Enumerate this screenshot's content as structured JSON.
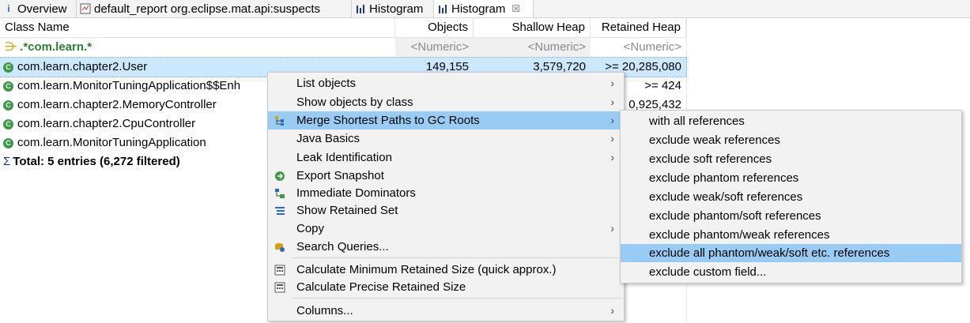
{
  "tabs": [
    {
      "label": "Overview",
      "icon": "info-icon"
    },
    {
      "label": "default_report  org.eclipse.mat.api:suspects",
      "icon": "report-icon"
    },
    {
      "label": "Histogram",
      "icon": "histogram-icon"
    },
    {
      "label": "Histogram",
      "icon": "histogram-icon",
      "active": true,
      "close": "☒"
    }
  ],
  "columns": {
    "class_name": "Class Name",
    "objects": "Objects",
    "shallow_heap": "Shallow Heap",
    "retained_heap": "Retained Heap"
  },
  "filter": {
    "class_name": ".*com.learn.*",
    "objects": "<Numeric>",
    "shallow_heap": "<Numeric>",
    "retained_heap": "<Numeric>"
  },
  "rows": [
    {
      "name": "com.learn.chapter2.User",
      "objects": "149,155",
      "shallow": "3,579,720",
      "retained": ">= 20,285,080"
    },
    {
      "name": "com.learn.MonitorTuningApplication$$Enh",
      "objects": "",
      "shallow": "",
      "retained": ">= 424"
    },
    {
      "name": "com.learn.chapter2.MemoryController",
      "objects": "",
      "shallow": "",
      "retained": "0,925,432"
    },
    {
      "name": "com.learn.chapter2.CpuController",
      "objects": "",
      "shallow": "",
      "retained": ""
    },
    {
      "name": "com.learn.MonitorTuningApplication",
      "objects": "",
      "shallow": "",
      "retained": ""
    }
  ],
  "total": "Total: 5 entries (6,272 filtered)",
  "context_menu": [
    {
      "label": "List objects",
      "submenu": true
    },
    {
      "label": "Show objects by class",
      "submenu": true
    },
    {
      "label": "Merge Shortest Paths to GC Roots",
      "submenu": true,
      "highlighted": true,
      "icon": "merge-paths-icon"
    },
    {
      "label": "Java Basics",
      "submenu": true
    },
    {
      "label": "Leak Identification",
      "submenu": true
    },
    {
      "label": "Export Snapshot",
      "icon": "export-icon"
    },
    {
      "label": "Immediate Dominators",
      "icon": "dominators-icon"
    },
    {
      "label": "Show Retained Set",
      "icon": "retained-set-icon"
    },
    {
      "label": "Copy",
      "submenu": true
    },
    {
      "label": "Search Queries...",
      "icon": "search-queries-icon"
    },
    {
      "label": "Calculate Minimum Retained Size (quick approx.)",
      "icon": "calculator-icon"
    },
    {
      "label": "Calculate Precise Retained Size",
      "icon": "calculator-icon"
    },
    {
      "label": "Columns...",
      "submenu": true
    }
  ],
  "submenu": [
    {
      "label": "with all references"
    },
    {
      "label": "exclude weak references"
    },
    {
      "label": "exclude soft references"
    },
    {
      "label": "exclude phantom references"
    },
    {
      "label": "exclude weak/soft references"
    },
    {
      "label": "exclude phantom/soft references"
    },
    {
      "label": "exclude phantom/weak references"
    },
    {
      "label": "exclude all phantom/weak/soft etc. references",
      "highlighted": true
    },
    {
      "label": "exclude custom field..."
    }
  ],
  "colors": {
    "highlight": "#99ccf5",
    "selection": "#cce8ff",
    "filter_text": "#2e7d32"
  }
}
